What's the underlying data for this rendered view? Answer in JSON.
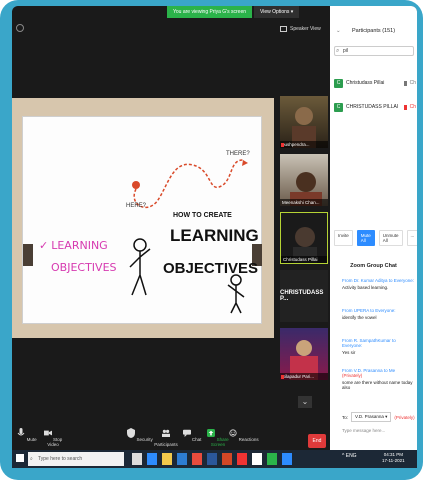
{
  "banner": {
    "message": "You are viewing Priya G's screen",
    "options_label": "View Options ▾"
  },
  "top": {
    "speaker_view_label": "Speaker View"
  },
  "slide": {
    "title": "",
    "learning_line1": "LEARNING",
    "learning_line2": "OBJECTIVES",
    "graphic_here": "HERE?",
    "graphic_there": "THERE?",
    "graphic_line1": "HOW TO CREATE",
    "graphic_line2": "LEARNING",
    "graphic_line3": "OBJECTIVES"
  },
  "gallery": {
    "items": [
      {
        "name": "pushpendra..."
      },
      {
        "name": "Meenakshi Chan..."
      },
      {
        "name": "Christudass Pillai"
      },
      {
        "name": "CHRISTUDASS P..."
      },
      {
        "name": "Silapadur Pari..."
      }
    ]
  },
  "toolbar": {
    "mute": "Mute",
    "stop_video": "Stop Video",
    "security": "Security",
    "participants": "Participants",
    "participants_count": "151",
    "chat": "Chat",
    "share_screen": "Share Screen",
    "reactions": "Reactions",
    "end": "End"
  },
  "panel": {
    "title": "Participants (151)",
    "search_value": "pil",
    "participants": [
      {
        "initial": "C",
        "name": "Christudass Pillai",
        "tag": "Ch",
        "muted": false
      },
      {
        "initial": "C",
        "name": "CHRISTUDASS PILLAI",
        "tag": "Ch",
        "muted": true
      }
    ],
    "invite": "Invite",
    "mute_all": "Mute All",
    "unmute_all": "Unmute All",
    "more": "...",
    "chat_title": "Zoom Group Chat",
    "messages": [
      {
        "from": "From Dr. Kumar Aditya to Everyone:",
        "private": "",
        "text": "Activity based learning."
      },
      {
        "from": "From UPERA to Everyone:",
        "private": "",
        "text": "identify the vowel"
      },
      {
        "from": "From R. SampathKumar to Everyone:",
        "private": "",
        "text": "Yes sir"
      },
      {
        "from": "From V.D. Prasanna to Me",
        "private": "(Privately)",
        "text": "some are there without name today also"
      }
    ],
    "to_label": "To:",
    "to_value": "V.D. Prasanna ▾",
    "to_private": "(Privately)",
    "input_placeholder": "Type message here..."
  },
  "taskbar": {
    "search_placeholder": "Type here to search",
    "tray": "^ ENG",
    "time": "04:31 PM",
    "date": "17-11-2021"
  }
}
